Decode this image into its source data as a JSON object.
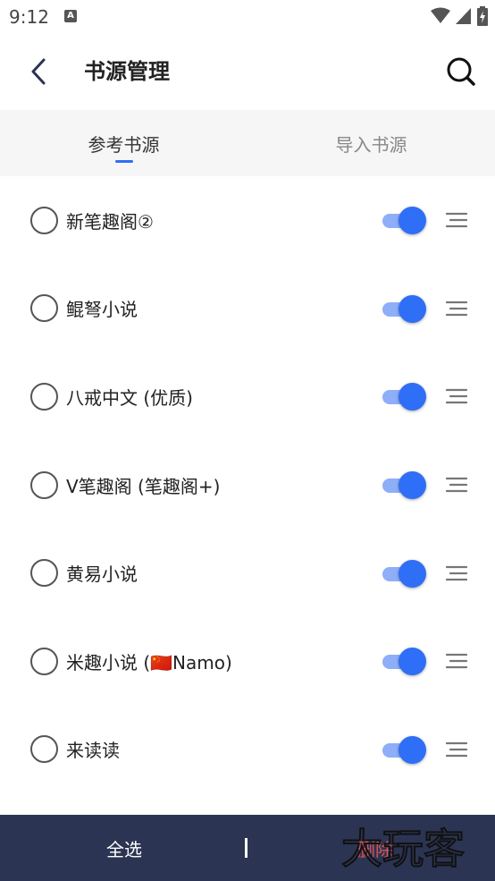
{
  "status_bar": {
    "time": "9:12",
    "notification_icon_letter": "A",
    "icons": [
      "notification-icon",
      "wifi-icon",
      "signal-icon",
      "battery-charging-icon"
    ]
  },
  "header": {
    "title": "书源管理",
    "back_icon": "back-arrow-icon",
    "search_icon": "search-icon"
  },
  "tabs": [
    {
      "label": "参考书源",
      "active": true
    },
    {
      "label": "导入书源",
      "active": false
    }
  ],
  "sources": [
    {
      "name": "新笔趣阁②",
      "selected": false,
      "enabled": true
    },
    {
      "name": "鲲弩小说",
      "selected": false,
      "enabled": true
    },
    {
      "name": "八戒中文 (优质)",
      "selected": false,
      "enabled": true
    },
    {
      "name": "V笔趣阁 (笔趣阁+)",
      "selected": false,
      "enabled": true
    },
    {
      "name": "黄易小说",
      "selected": false,
      "enabled": true
    },
    {
      "name": "米趣小说 (🇨🇳Namo)",
      "selected": false,
      "enabled": true
    },
    {
      "name": "来读读",
      "selected": false,
      "enabled": true
    }
  ],
  "bottom_bar": {
    "select_all_label": "全选",
    "delete_label": "删除",
    "watermark_text": "大玩客"
  },
  "colors": {
    "accent": "#2f6ef6",
    "toggle_track": "#8eaef8",
    "bottom_bar_bg": "#2b3452",
    "delete_text": "#e05555",
    "tab_bar_bg": "#f6f6f6"
  }
}
